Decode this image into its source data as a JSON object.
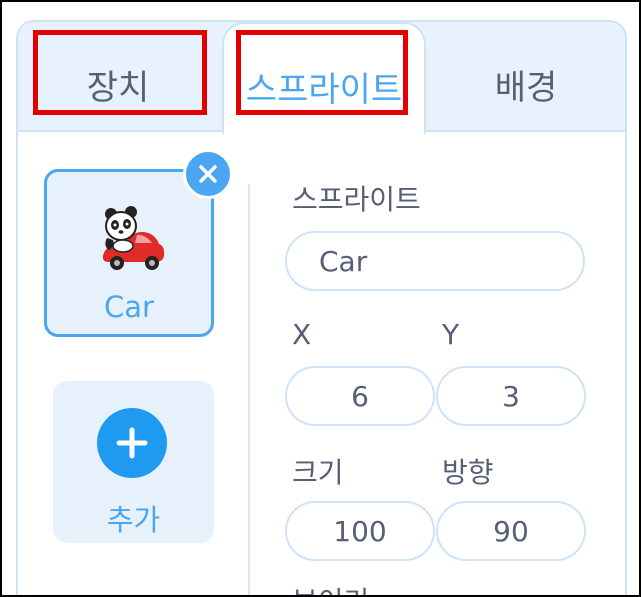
{
  "tabs": {
    "device": "장치",
    "sprite": "스프라이트",
    "background": "배경"
  },
  "sprite_list": {
    "items": [
      {
        "name": "Car",
        "selected": true,
        "thumbnail_icon": "panda-in-red-car-icon"
      }
    ],
    "add_label": "추가"
  },
  "properties": {
    "sprite_label": "스프라이트",
    "name_value": "Car",
    "x_label": "X",
    "x_value": "6",
    "y_label": "Y",
    "y_value": "3",
    "size_label": "크기",
    "size_value": "100",
    "direction_label": "방향",
    "direction_value": "90",
    "next_label_partial": "보이기"
  },
  "colors": {
    "accent": "#4aa6f2",
    "highlight": "#e20000",
    "panel_bg": "#e8f2fd",
    "text": "#575e75"
  }
}
